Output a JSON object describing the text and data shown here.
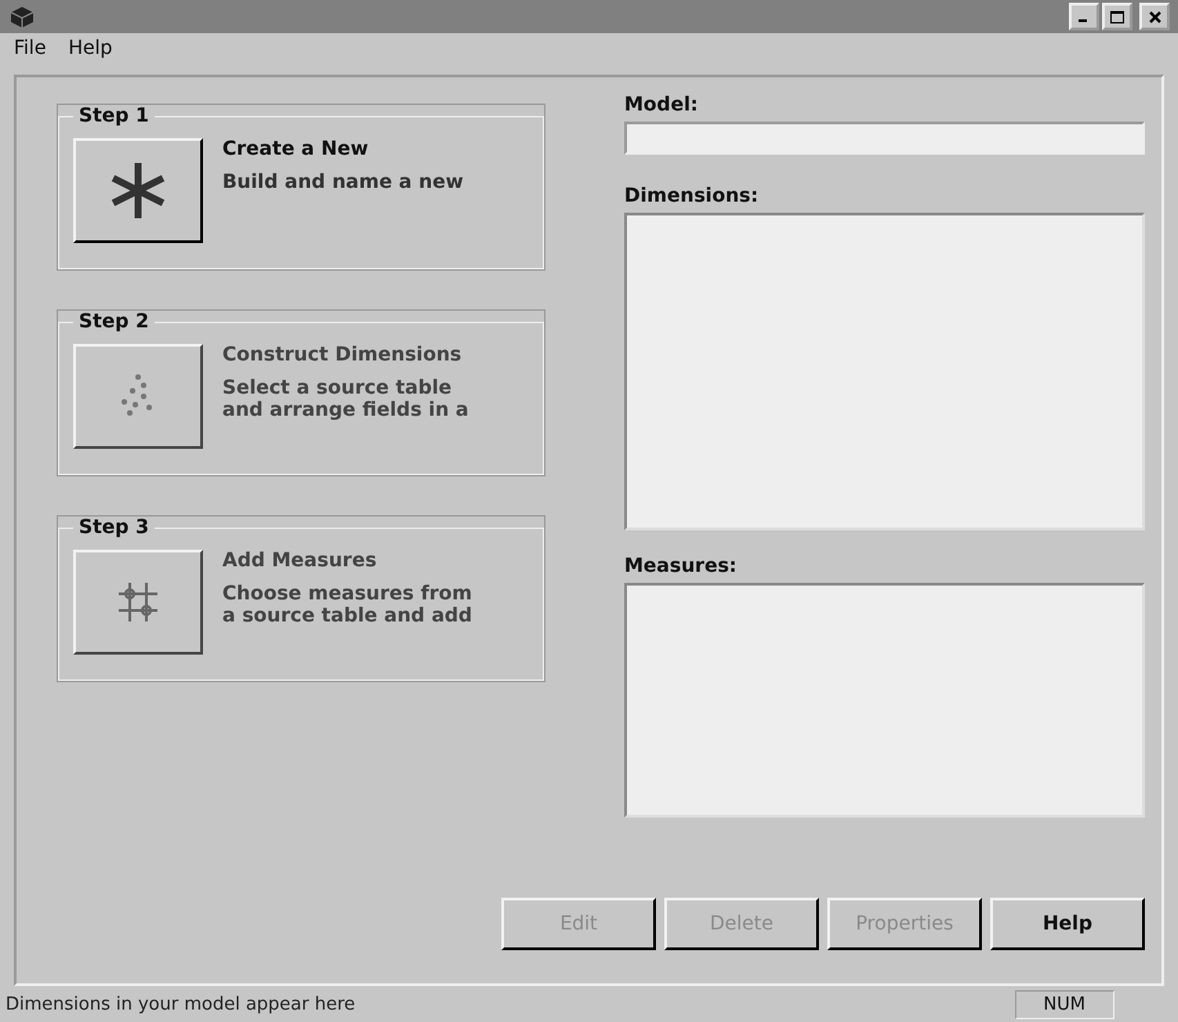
{
  "menu": [
    {
      "label": "File"
    },
    {
      "label": "Help"
    }
  ],
  "steps": [
    {
      "title": "Step 1",
      "heading": "Create a New",
      "description": "Build and name a new",
      "enabled": true
    },
    {
      "title": "Step 2",
      "heading": "Construct Dimensions",
      "description": "Select a source table and arrange fields in a",
      "enabled": false
    },
    {
      "title": "Step 3",
      "heading": "Add Measures",
      "description": "Choose measures from a source table and add",
      "enabled": false
    }
  ],
  "model": {
    "label": "Model:"
  },
  "dimensions": {
    "label": "Dimensions:"
  },
  "measures": {
    "label": "Measures:"
  },
  "buttons": [
    {
      "label": "Edit",
      "disabled": true
    },
    {
      "label": "Delete",
      "disabled": true
    },
    {
      "label": "Properties",
      "disabled": true
    },
    {
      "label": "Help",
      "disabled": false
    }
  ],
  "status_bar": {
    "message": "Dimensions in your model appear here",
    "indicator": "NUM"
  }
}
